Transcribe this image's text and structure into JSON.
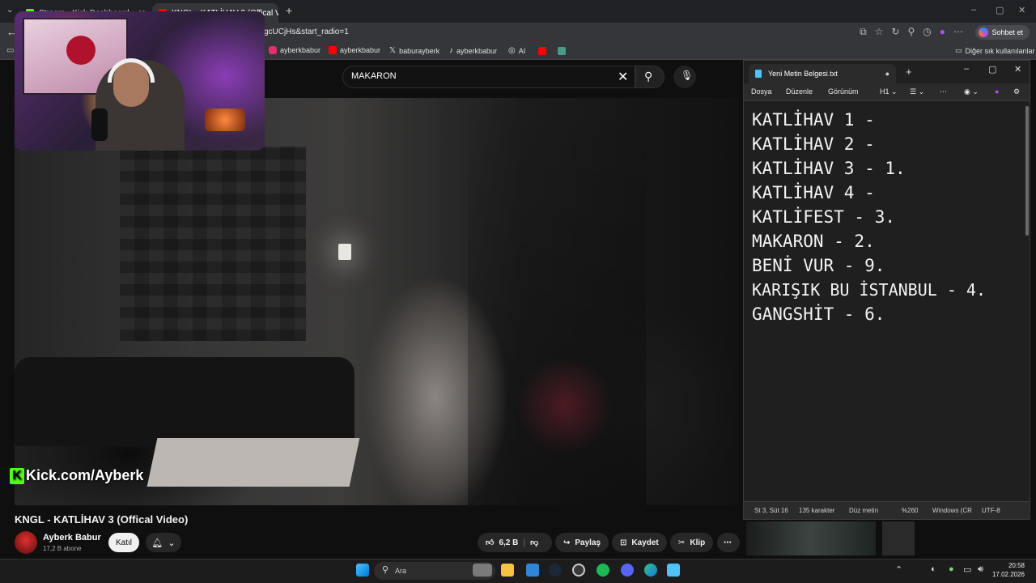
{
  "browser": {
    "tabs": [
      {
        "label": "Stream - Kick Dashboard"
      },
      {
        "label": "KNGL - KATLİHAV 3 (Offical V"
      }
    ],
    "url": "gcUCjHs&start_radio=1",
    "chat_button": "Sohbet et",
    "bookmarks": [
      {
        "label": "ayberkbabur",
        "icon": "instagram-icon",
        "color": "#e1306c"
      },
      {
        "label": "ayberkbabur",
        "icon": "youtube-icon",
        "color": "#ff0000"
      },
      {
        "label": "baburayberk",
        "icon": "x-icon",
        "color": "#ffffff"
      },
      {
        "label": "ayberkbabur",
        "icon": "tiktok-icon",
        "color": "#ffffff"
      },
      {
        "label": "AI",
        "icon": "ai-icon",
        "color": "#cccccc"
      }
    ],
    "other_bookmarks": "Diğer sık kullanılanlar"
  },
  "youtube": {
    "search_value": "MAKARON",
    "watermark": "Kick.com/Ayberk",
    "video_title": "KNGL - KATLİHAV 3 (Offical Video)",
    "channel_name": "Ayberk Babur",
    "subscribers": "17,2 B abone",
    "join_label": "Katıl",
    "likes": "6,2 B",
    "share_label": "Paylaş",
    "save_label": "Kaydet",
    "clip_label": "Klip"
  },
  "notepad": {
    "tab_title": "Yeni Metin Belgesi.txt",
    "menus": [
      "Dosya",
      "Düzenle",
      "Görünüm"
    ],
    "heading_select": "H1",
    "lines": [
      "KATLİHAV 1 -",
      "KATLİHAV 2 -",
      "KATLİHAV 3 - 1.",
      "KATLİHAV 4 -",
      "KATLİFEST - 3.",
      "MAKARON - 2.",
      "BENİ VUR - 9.",
      "KARIŞIK BU İSTANBUL - 4.",
      "GANGSHİT - 6."
    ],
    "status": {
      "position": "St 3, Süt 16",
      "chars": "135 karakter",
      "format": "Düz metin",
      "zoom": "%260",
      "line_ending": "Windows (CR",
      "encoding": "UTF-8"
    }
  },
  "taskbar": {
    "search_placeholder": "Ara",
    "time": "20:58",
    "date": "17.02.2026"
  },
  "colors": {
    "kick_green": "#53fc18",
    "youtube_red": "#ff0000"
  }
}
